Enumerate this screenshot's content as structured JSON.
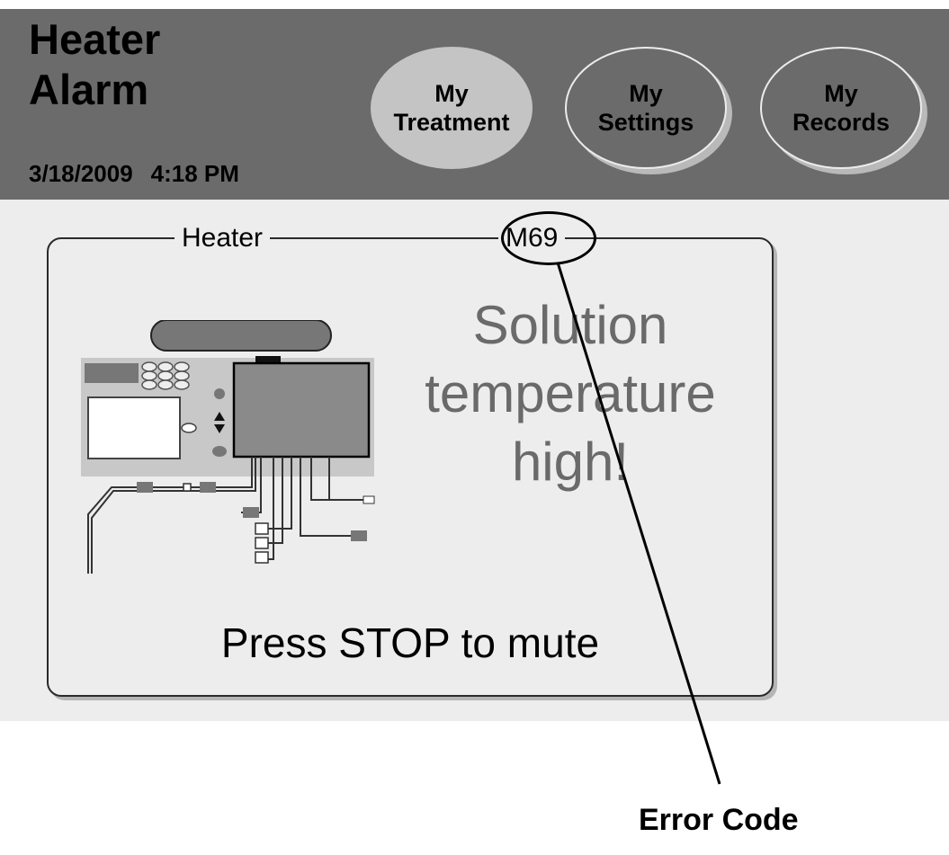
{
  "header": {
    "title": "Heater\nAlarm",
    "date": "3/18/2009",
    "time": "4:18 PM"
  },
  "nav": {
    "treatment": "My\nTreatment",
    "settings": "My\nSettings",
    "records": "My\nRecords",
    "active": "treatment"
  },
  "alarm": {
    "category": "Heater",
    "code": "M69",
    "message": "Solution\ntemperature\nhigh!",
    "instruction": "Press STOP to mute"
  },
  "annotation": {
    "label": "Error Code"
  },
  "colors": {
    "header_bg": "#6b6b6b",
    "screen_bg": "#ededed",
    "button_active": "#c4c4c4",
    "message_text": "#6a6a6a"
  }
}
